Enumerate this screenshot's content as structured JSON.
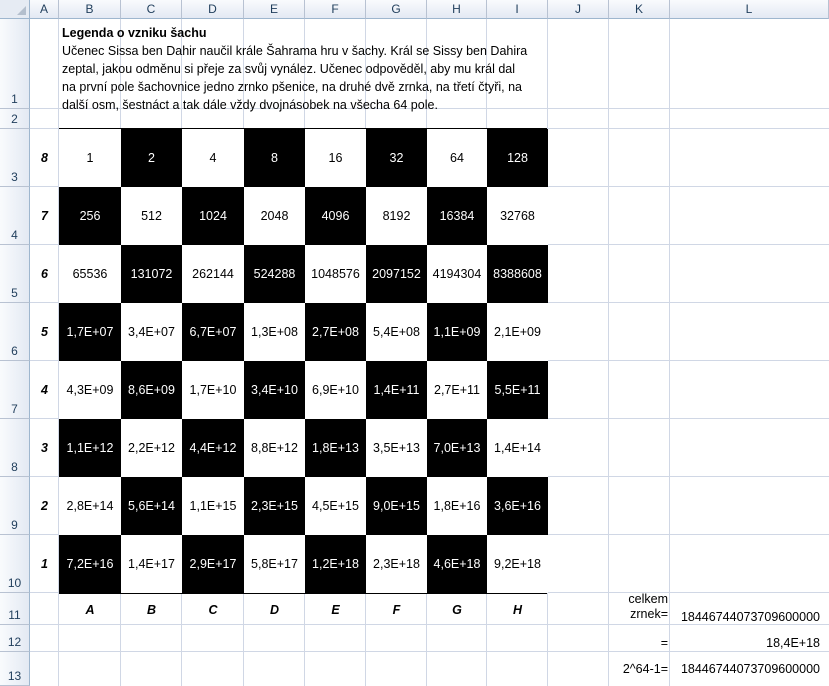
{
  "columns": [
    "A",
    "B",
    "C",
    "D",
    "E",
    "F",
    "G",
    "H",
    "I",
    "J",
    "K",
    "L"
  ],
  "rows": [
    "1",
    "2",
    "3",
    "4",
    "5",
    "6",
    "7",
    "8",
    "9",
    "10",
    "11",
    "12",
    "13"
  ],
  "legend": {
    "title": "Legenda o vzniku šachu",
    "text": "Učenec Sissa ben Dahir naučil krále Šahrama hru v šachy. Král se Sissy ben Dahira zeptal, jakou odměnu si přeje za svůj vynález. Učenec odpověděl, aby mu král dal na první pole šachovnice jedno zrnko pšenice, na druhé dvě zrnka, na třetí čtyři, na další osm, šestnáct a tak dále vždy dvojnásobek na všecha 64 pole."
  },
  "board": {
    "rank_labels": [
      "8",
      "7",
      "6",
      "5",
      "4",
      "3",
      "2",
      "1"
    ],
    "file_labels": [
      "A",
      "B",
      "C",
      "D",
      "E",
      "F",
      "G",
      "H"
    ],
    "ranks": [
      [
        "1",
        "2",
        "4",
        "8",
        "16",
        "32",
        "64",
        "128"
      ],
      [
        "256",
        "512",
        "1024",
        "2048",
        "4096",
        "8192",
        "16384",
        "32768"
      ],
      [
        "65536",
        "131072",
        "262144",
        "524288",
        "1048576",
        "2097152",
        "4194304",
        "8388608"
      ],
      [
        "1,7E+07",
        "3,4E+07",
        "6,7E+07",
        "1,3E+08",
        "2,7E+08",
        "5,4E+08",
        "1,1E+09",
        "2,1E+09"
      ],
      [
        "4,3E+09",
        "8,6E+09",
        "1,7E+10",
        "3,4E+10",
        "6,9E+10",
        "1,4E+11",
        "2,7E+11",
        "5,5E+11"
      ],
      [
        "1,1E+12",
        "2,2E+12",
        "4,4E+12",
        "8,8E+12",
        "1,8E+13",
        "3,5E+13",
        "7,0E+13",
        "1,4E+14"
      ],
      [
        "2,8E+14",
        "5,6E+14",
        "1,1E+15",
        "2,3E+15",
        "4,5E+15",
        "9,0E+15",
        "1,8E+16",
        "3,6E+16"
      ],
      [
        "7,2E+16",
        "1,4E+17",
        "2,9E+17",
        "5,8E+17",
        "1,2E+18",
        "2,3E+18",
        "4,6E+18",
        "9,2E+18"
      ]
    ]
  },
  "summary": {
    "total_label": "celkem zrnek=",
    "total_value": "18446744073709600000",
    "eq_label": "=",
    "eq_value": "18,4E+18",
    "formula_label": "2^64-1=",
    "formula_value": "18446744073709600000"
  }
}
